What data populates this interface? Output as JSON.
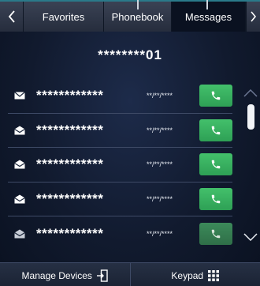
{
  "tabs": {
    "back_icon": "chevron-left-icon",
    "items": [
      {
        "label": "Favorites",
        "active": false
      },
      {
        "label": "Phonebook",
        "active": false
      },
      {
        "label": "Messages",
        "active": true
      }
    ],
    "forward_icon": "chevron-right-icon"
  },
  "title": "********01",
  "messages": [
    {
      "icon": "envelope-closed-icon",
      "name": "************",
      "date": "**/**/****"
    },
    {
      "icon": "envelope-open-icon",
      "name": "************",
      "date": "**/**/****"
    },
    {
      "icon": "envelope-open-icon",
      "name": "************",
      "date": "**/**/****"
    },
    {
      "icon": "envelope-open-icon",
      "name": "************",
      "date": "**/**/****"
    },
    {
      "icon": "envelope-open-icon",
      "name": "************",
      "date": "**/**/****"
    }
  ],
  "bottom": {
    "manage_label": "Manage Devices",
    "keypad_label": "Keypad"
  },
  "colors": {
    "call_button": "#3ab35f",
    "background": "#111a2e",
    "accent": "#2a7a8a"
  }
}
